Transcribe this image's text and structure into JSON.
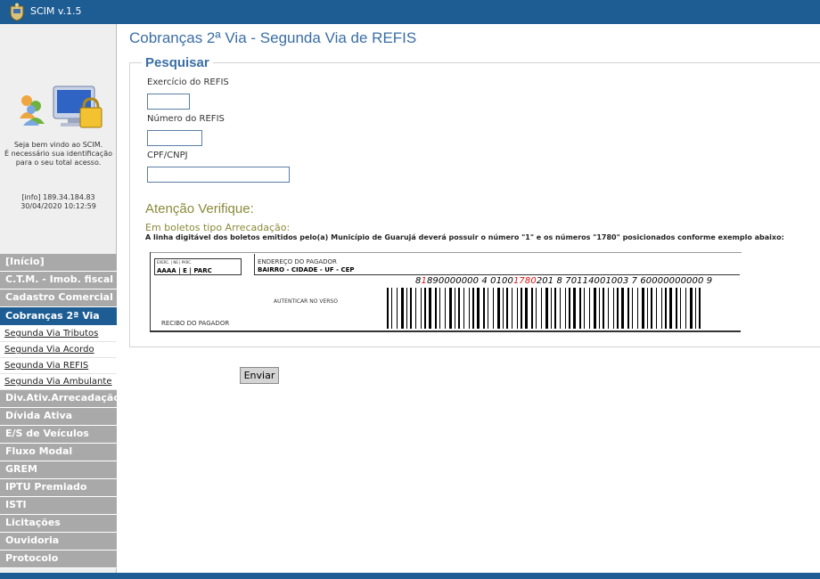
{
  "app": {
    "title": "SCIM v.1.5",
    "logo_icon": "coat-of-arms-icon"
  },
  "colors": {
    "topbar": "#1d5d94",
    "menu_inactive": "#a9a9a9",
    "menu_active": "#1d5d94",
    "title": "#3a6ea5",
    "attention": "#8a8a3a",
    "barcode_red": "#d11111"
  },
  "sidebar": {
    "welcome_icon": "computer-users-lock-icon",
    "welcome_lines": [
      "Seja bem vindo ao SCIM.",
      "É necessário sua identificação",
      "para o seu total acesso."
    ],
    "info_lines": [
      "[info] 189.34.184.83",
      "30/04/2020 10:12:59"
    ],
    "menu": [
      {
        "label": "[Início]"
      },
      {
        "label": "C.T.M. - Imob. fiscal"
      },
      {
        "label": "Cadastro Comercial"
      },
      {
        "label": "Cobranças 2ª Via",
        "active": true
      }
    ],
    "submenu": [
      "Segunda Via Tributos",
      "Segunda Via Acordo",
      "Segunda Via REFIS",
      "Segunda Via Ambulante"
    ],
    "menu2": [
      "Div.Ativ.Arrecadação",
      "Dívida Ativa",
      "E/S de Veículos",
      "Fluxo Modal",
      "GREM",
      "IPTU Premiado",
      "ISTI",
      "Licitações",
      "Ouvidoria",
      "Protocolo"
    ]
  },
  "main": {
    "title": "Cobranças 2ª Via - Segunda Via de REFIS",
    "legend": "Pesquisar",
    "fields": [
      {
        "label": "Exercício do REFIS",
        "value": ""
      },
      {
        "label": "Número do REFIS",
        "value": ""
      },
      {
        "label": "CPF/CNPJ",
        "value": ""
      }
    ],
    "attention_title": "Atenção Verifique:",
    "arrecadacao_label": "Em boletos tipo Arrecadação:",
    "note": "A linha digitável dos boletos emitidos pelo(a) Município de Guarujá deverá possuir o número \"1\" e os números \"1780\" posicionados conforme exemplo abaixo:",
    "boleto": {
      "box1_small": "EXERC. | NE | PARC.",
      "box1_value": "AAAA | E | PARC",
      "box2_line1": "ENDEREÇO DO PAGADOR",
      "box2_line2": "BAIRRO - CIDADE - UF - CEP",
      "digitable_prefix": "8",
      "digitable_red1": "1",
      "digitable_mid": "890000000 4 0100",
      "digitable_red2": "1780",
      "digitable_suffix": "201 8 70114001003 7 60000000000 9",
      "autenticar": "AUTENTICAR NO VERSO",
      "recibo": "RECIBO DO PAGADOR"
    },
    "send_label": "Enviar"
  }
}
